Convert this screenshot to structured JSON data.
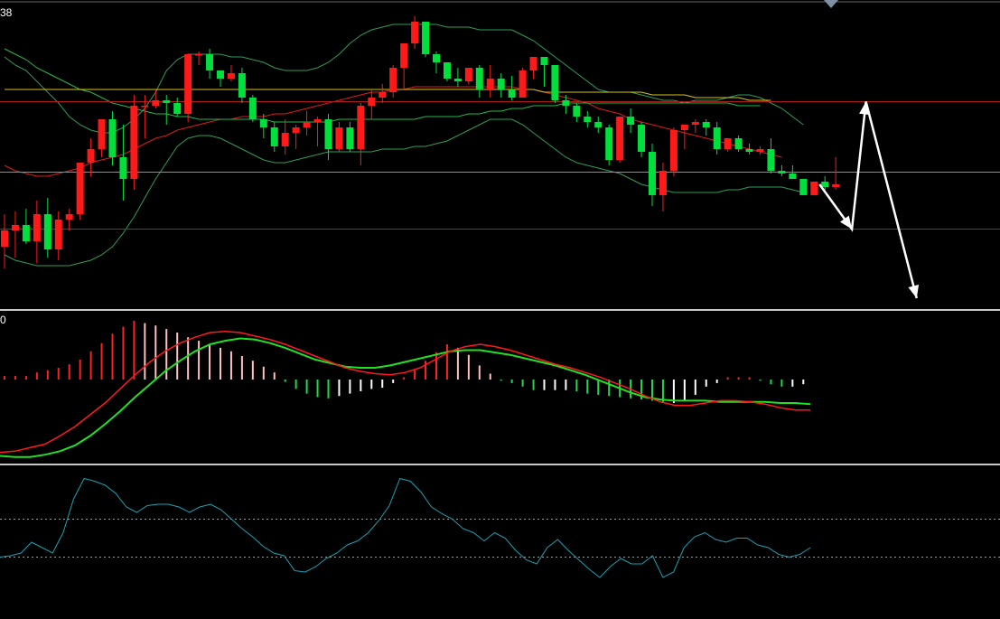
{
  "header": {
    "corner_fragment": "38",
    "macd_fragment": "0"
  },
  "colors": {
    "background": "#000000",
    "bull": "#00e03c",
    "bear": "#ff1a1a",
    "bb_outer": "#2e9c5a",
    "ma_short": "#e01a1a",
    "ma_mid": "#22b84a",
    "ma_long": "#d8c21a",
    "hline": "#aa1e1e",
    "hline_mid": "#8c8c8c",
    "dif": "#ff1a1a",
    "dea": "#22e022",
    "hist_pos_strong": "#ff2020",
    "hist_pos_weak": "#ffc0c0",
    "hist_neg_strong": "#22d84a",
    "hist_neg_weak": "#ffffff",
    "osc": "#1aa0b0",
    "osc_ref": "#9a9a9a",
    "separator": "#c8c8c8",
    "arrow": "#ffffff"
  },
  "chart_data": [
    {
      "type": "candlestick",
      "name": "price",
      "grid": false,
      "ylim": [
        0,
        100
      ],
      "candles": [
        {
          "o": 15,
          "h": 27,
          "l": 7,
          "c": 21
        },
        {
          "o": 21,
          "h": 28,
          "l": 11,
          "c": 23
        },
        {
          "o": 23,
          "h": 29,
          "l": 16,
          "c": 17
        },
        {
          "o": 17,
          "h": 32,
          "l": 9,
          "c": 27
        },
        {
          "o": 27,
          "h": 33,
          "l": 11,
          "c": 14
        },
        {
          "o": 14,
          "h": 28,
          "l": 10,
          "c": 25
        },
        {
          "o": 25,
          "h": 29,
          "l": 21,
          "c": 27
        },
        {
          "o": 27,
          "h": 46,
          "l": 25,
          "c": 46
        },
        {
          "o": 46,
          "h": 55,
          "l": 41,
          "c": 51
        },
        {
          "o": 51,
          "h": 62,
          "l": 48,
          "c": 62
        },
        {
          "o": 62,
          "h": 65,
          "l": 45,
          "c": 48
        },
        {
          "o": 48,
          "h": 60,
          "l": 32,
          "c": 40
        },
        {
          "o": 40,
          "h": 71,
          "l": 36,
          "c": 67
        },
        {
          "o": 67,
          "h": 71,
          "l": 55,
          "c": 67
        },
        {
          "o": 67,
          "h": 73,
          "l": 66,
          "c": 69
        },
        {
          "o": 69,
          "h": 71,
          "l": 60,
          "c": 68
        },
        {
          "o": 68,
          "h": 70,
          "l": 63,
          "c": 64
        },
        {
          "o": 64,
          "h": 86,
          "l": 61,
          "c": 86
        },
        {
          "o": 86,
          "h": 87,
          "l": 82,
          "c": 86
        },
        {
          "o": 86,
          "h": 88,
          "l": 77,
          "c": 80
        },
        {
          "o": 80,
          "h": 80,
          "l": 74,
          "c": 77
        },
        {
          "o": 77,
          "h": 82,
          "l": 76,
          "c": 79
        },
        {
          "o": 79,
          "h": 81,
          "l": 68,
          "c": 70
        },
        {
          "o": 70,
          "h": 71,
          "l": 61,
          "c": 62
        },
        {
          "o": 62,
          "h": 64,
          "l": 55,
          "c": 59
        },
        {
          "o": 59,
          "h": 61,
          "l": 50,
          "c": 52
        },
        {
          "o": 52,
          "h": 62,
          "l": 49,
          "c": 57
        },
        {
          "o": 57,
          "h": 60,
          "l": 51,
          "c": 59
        },
        {
          "o": 59,
          "h": 65,
          "l": 56,
          "c": 61
        },
        {
          "o": 61,
          "h": 63,
          "l": 52,
          "c": 62
        },
        {
          "o": 62,
          "h": 64,
          "l": 47,
          "c": 51
        },
        {
          "o": 51,
          "h": 61,
          "l": 50,
          "c": 59
        },
        {
          "o": 59,
          "h": 61,
          "l": 50,
          "c": 51
        },
        {
          "o": 51,
          "h": 68,
          "l": 45,
          "c": 67
        },
        {
          "o": 67,
          "h": 73,
          "l": 62,
          "c": 70
        },
        {
          "o": 70,
          "h": 75,
          "l": 68,
          "c": 72
        },
        {
          "o": 72,
          "h": 82,
          "l": 70,
          "c": 81
        },
        {
          "o": 81,
          "h": 84,
          "l": 73,
          "c": 90
        },
        {
          "o": 90,
          "h": 100,
          "l": 88,
          "c": 98
        },
        {
          "o": 98,
          "h": 98,
          "l": 85,
          "c": 86
        },
        {
          "o": 86,
          "h": 87,
          "l": 79,
          "c": 83
        },
        {
          "o": 83,
          "h": 83,
          "l": 76,
          "c": 77
        },
        {
          "o": 77,
          "h": 81,
          "l": 74,
          "c": 76
        },
        {
          "o": 76,
          "h": 81,
          "l": 75,
          "c": 81
        },
        {
          "o": 81,
          "h": 82,
          "l": 70,
          "c": 73
        },
        {
          "o": 73,
          "h": 82,
          "l": 70,
          "c": 77
        },
        {
          "o": 77,
          "h": 79,
          "l": 70,
          "c": 73
        },
        {
          "o": 73,
          "h": 78,
          "l": 69,
          "c": 70
        },
        {
          "o": 70,
          "h": 81,
          "l": 70,
          "c": 80
        },
        {
          "o": 80,
          "h": 85,
          "l": 77,
          "c": 85
        },
        {
          "o": 85,
          "h": 85,
          "l": 74,
          "c": 82
        },
        {
          "o": 82,
          "h": 82,
          "l": 68,
          "c": 69
        },
        {
          "o": 69,
          "h": 71,
          "l": 64,
          "c": 67
        },
        {
          "o": 67,
          "h": 68,
          "l": 61,
          "c": 63
        },
        {
          "o": 63,
          "h": 65,
          "l": 59,
          "c": 61
        },
        {
          "o": 61,
          "h": 63,
          "l": 57,
          "c": 59
        },
        {
          "o": 59,
          "h": 60,
          "l": 45,
          "c": 47
        },
        {
          "o": 47,
          "h": 62,
          "l": 46,
          "c": 63
        },
        {
          "o": 63,
          "h": 66,
          "l": 57,
          "c": 60
        },
        {
          "o": 60,
          "h": 61,
          "l": 48,
          "c": 50
        },
        {
          "o": 50,
          "h": 53,
          "l": 30,
          "c": 34
        },
        {
          "o": 34,
          "h": 46,
          "l": 28,
          "c": 43
        },
        {
          "o": 43,
          "h": 59,
          "l": 41,
          "c": 58
        },
        {
          "o": 58,
          "h": 60,
          "l": 51,
          "c": 60
        },
        {
          "o": 60,
          "h": 62,
          "l": 57,
          "c": 61
        },
        {
          "o": 61,
          "h": 62,
          "l": 56,
          "c": 59
        },
        {
          "o": 59,
          "h": 61,
          "l": 49,
          "c": 51
        },
        {
          "o": 51,
          "h": 55,
          "l": 50,
          "c": 55
        },
        {
          "o": 55,
          "h": 56,
          "l": 50,
          "c": 51
        },
        {
          "o": 51,
          "h": 53,
          "l": 49,
          "c": 50
        },
        {
          "o": 50,
          "h": 52,
          "l": 49,
          "c": 51
        },
        {
          "o": 51,
          "h": 55,
          "l": 42,
          "c": 43
        },
        {
          "o": 43,
          "h": 45,
          "l": 41,
          "c": 42
        },
        {
          "o": 42,
          "h": 45,
          "l": 40,
          "c": 40
        },
        {
          "o": 40,
          "h": 40,
          "l": 34,
          "c": 34
        },
        {
          "o": 34,
          "h": 39,
          "l": 34,
          "c": 39
        },
        {
          "o": 39,
          "h": 41,
          "l": 36,
          "c": 37
        },
        {
          "o": 37,
          "h": 48,
          "l": 36,
          "c": 38
        }
      ],
      "overlays": [
        {
          "role": "bb_upper",
          "values": [
            85,
            82,
            80,
            76,
            72,
            68,
            63,
            60,
            58,
            57,
            57,
            59,
            62,
            66,
            72,
            80,
            84,
            86,
            86,
            86,
            86,
            85,
            85,
            84,
            83,
            81,
            80,
            80,
            80,
            81,
            83,
            86,
            90,
            93,
            95,
            96,
            97,
            97,
            97,
            97,
            97,
            96,
            96,
            96,
            95,
            95,
            95,
            95,
            93,
            91,
            88,
            85,
            82,
            79,
            76,
            73,
            72,
            72,
            72,
            71,
            70,
            69,
            69,
            68,
            69,
            69,
            69,
            70,
            71,
            71,
            70,
            68,
            66,
            63,
            60
          ]
        },
        {
          "role": "bb_lower",
          "values": [
            12,
            10,
            9,
            8,
            8,
            8,
            8,
            9,
            10,
            12,
            15,
            20,
            26,
            33,
            40,
            46,
            52,
            55,
            56,
            56,
            55,
            53,
            51,
            49,
            47,
            46,
            46,
            47,
            48,
            49,
            50,
            50,
            50,
            50,
            50,
            51,
            51,
            51,
            52,
            52,
            53,
            54,
            56,
            58,
            60,
            62,
            62,
            62,
            60,
            57,
            54,
            51,
            48,
            46,
            45,
            44,
            43,
            42,
            40,
            38,
            37,
            36,
            35,
            35,
            35,
            35,
            35,
            36,
            36,
            37,
            37,
            37,
            37,
            36,
            35
          ]
        },
        {
          "role": "ma_short",
          "values": [
            45,
            43,
            42,
            41,
            41,
            42,
            43,
            44,
            46,
            47,
            48,
            49,
            51,
            53,
            55,
            56,
            58,
            59,
            60,
            61,
            62,
            62,
            63,
            63,
            63,
            64,
            64,
            65,
            66,
            67,
            68,
            69,
            70,
            71,
            72,
            72,
            73,
            73,
            74,
            74,
            74,
            74,
            74,
            74,
            74,
            74,
            74,
            74,
            73,
            73,
            72,
            71,
            70,
            69,
            68,
            66,
            65,
            64,
            62,
            61,
            60,
            59,
            58,
            57,
            56,
            55,
            54,
            53,
            52,
            51,
            50,
            49,
            48
          ]
        },
        {
          "role": "ma_mid",
          "values": [
            88,
            86,
            84,
            81,
            79,
            77,
            75,
            73,
            72,
            70,
            68,
            67,
            66,
            65,
            64,
            64,
            63,
            63,
            62,
            62,
            62,
            62,
            62,
            62,
            62,
            61,
            61,
            61,
            61,
            61,
            61,
            62,
            62,
            62,
            62,
            62,
            62,
            62,
            62,
            63,
            63,
            63,
            63,
            64,
            64,
            65,
            65,
            66,
            66,
            67,
            67,
            67,
            68,
            68,
            68,
            68,
            68,
            68,
            68,
            68,
            68,
            68,
            68,
            68,
            68,
            68,
            68,
            68,
            67,
            67,
            67
          ]
        },
        {
          "role": "ma_long",
          "values": [
            73,
            73,
            73,
            73,
            73,
            73,
            73,
            73,
            73,
            73,
            73,
            73,
            73,
            73,
            73,
            73,
            73,
            73,
            73,
            73,
            73,
            73,
            73,
            73,
            73,
            73,
            73,
            73,
            73,
            73,
            73,
            73,
            73,
            73,
            73,
            73,
            73,
            73,
            73,
            73,
            73,
            73,
            73,
            73,
            73,
            73,
            73,
            73,
            73,
            73,
            72,
            72,
            72,
            72,
            72,
            72,
            72,
            72,
            72,
            72,
            71,
            71,
            71,
            71,
            70,
            70,
            70,
            70,
            70,
            69,
            69,
            69
          ]
        }
      ],
      "hlines": [
        {
          "value": 68.5,
          "role": "resistance"
        },
        {
          "value": 42.5,
          "role": "middle"
        },
        {
          "value": 21.5,
          "role": "support"
        }
      ],
      "annotation_arrow": {
        "description": "projected path",
        "points": [
          [
            75.5,
            38
          ],
          [
            78.5,
            21.5
          ],
          [
            79.8,
            68.5
          ],
          [
            84.5,
            -4
          ]
        ]
      }
    },
    {
      "type": "macd",
      "name": "macd",
      "grid": false,
      "ylim": [
        -1,
        1
      ],
      "histogram": [
        0.03,
        0.03,
        0.03,
        0.06,
        0.08,
        0.1,
        0.13,
        0.17,
        0.24,
        0.31,
        0.39,
        0.45,
        0.5,
        0.48,
        0.46,
        0.43,
        0.4,
        0.36,
        0.33,
        0.3,
        0.27,
        0.24,
        0.2,
        0.16,
        0.11,
        0.06,
        -0.02,
        -0.08,
        -0.12,
        -0.15,
        -0.16,
        -0.14,
        -0.12,
        -0.1,
        -0.08,
        -0.07,
        -0.03,
        0.02,
        0.08,
        0.16,
        0.23,
        0.3,
        0.27,
        0.21,
        0.12,
        0.05,
        -0.01,
        -0.03,
        -0.06,
        -0.09,
        -0.09,
        -0.09,
        -0.09,
        -0.1,
        -0.12,
        -0.13,
        -0.14,
        -0.15,
        -0.16,
        -0.17,
        -0.18,
        -0.2,
        -0.2,
        -0.18,
        -0.13,
        -0.06,
        -0.03,
        0.02,
        0.02,
        0.02,
        -0.01,
        -0.04,
        -0.06,
        -0.06,
        -0.04
      ],
      "dif": [
        -0.62,
        -0.61,
        -0.58,
        -0.55,
        -0.48,
        -0.4,
        -0.3,
        -0.2,
        -0.08,
        0.04,
        0.15,
        0.24,
        0.31,
        0.36,
        0.4,
        0.41,
        0.4,
        0.37,
        0.34,
        0.3,
        0.25,
        0.2,
        0.15,
        0.1,
        0.07,
        0.05,
        0.04,
        0.06,
        0.1,
        0.17,
        0.24,
        0.28,
        0.3,
        0.28,
        0.25,
        0.21,
        0.17,
        0.13,
        0.1,
        0.06,
        0.02,
        -0.03,
        -0.08,
        -0.14,
        -0.19,
        -0.22,
        -0.22,
        -0.2,
        -0.18,
        -0.18,
        -0.19,
        -0.21,
        -0.24,
        -0.26,
        -0.26
      ],
      "dea": [
        -0.65,
        -0.66,
        -0.66,
        -0.64,
        -0.61,
        -0.56,
        -0.48,
        -0.38,
        -0.27,
        -0.15,
        -0.04,
        0.07,
        0.16,
        0.24,
        0.3,
        0.33,
        0.35,
        0.34,
        0.31,
        0.27,
        0.22,
        0.17,
        0.14,
        0.11,
        0.1,
        0.1,
        0.12,
        0.15,
        0.18,
        0.21,
        0.24,
        0.25,
        0.25,
        0.23,
        0.21,
        0.18,
        0.15,
        0.12,
        0.08,
        0.04,
        -0.01,
        -0.06,
        -0.11,
        -0.15,
        -0.17,
        -0.18,
        -0.18,
        -0.18,
        -0.19,
        -0.19,
        -0.19,
        -0.19,
        -0.2,
        -0.2,
        -0.21
      ]
    },
    {
      "type": "line",
      "name": "oscillator",
      "grid": false,
      "ylim": [
        0,
        100
      ],
      "ref_levels": [
        65,
        37
      ],
      "values": [
        37,
        38,
        40,
        48,
        44,
        40,
        55,
        80,
        95,
        93,
        90,
        84,
        74,
        70,
        75,
        76,
        76,
        74,
        70,
        74,
        76,
        72,
        65,
        58,
        52,
        45,
        40,
        38,
        27,
        26,
        30,
        36,
        40,
        46,
        49,
        55,
        64,
        75,
        95,
        93,
        85,
        74,
        69,
        65,
        58,
        55,
        49,
        55,
        51,
        42,
        35,
        32,
        44,
        50,
        42,
        35,
        28,
        22,
        30,
        36,
        32,
        32,
        38,
        22,
        26,
        44,
        52,
        55,
        50,
        48,
        51,
        51,
        46,
        44,
        39,
        37,
        39,
        44
      ]
    }
  ]
}
